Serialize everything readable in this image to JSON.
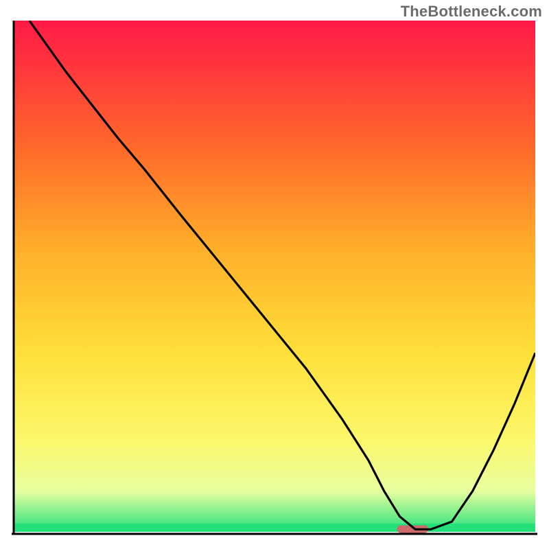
{
  "watermark": "TheBottleneck.com",
  "colors": {
    "gradient_top": "#ff1a47",
    "gradient_mid1": "#ff6a2a",
    "gradient_mid2": "#ffb02a",
    "gradient_mid3": "#ffe03a",
    "gradient_mid4": "#fcf86b",
    "gradient_low": "#e8ffa0",
    "gradient_green": "#23e07a",
    "curve": "#000000",
    "axis": "#000000",
    "marker": "#cf6a6a"
  },
  "chart_data": {
    "type": "line",
    "title": "",
    "xlabel": "",
    "ylabel": "",
    "xlim": [
      0,
      100
    ],
    "ylim": [
      0,
      100
    ],
    "x": [
      3,
      10,
      20,
      25,
      32,
      40,
      48,
      56,
      63,
      68,
      71,
      74,
      77,
      80,
      84,
      88,
      92,
      96,
      100
    ],
    "values": [
      100,
      90,
      77,
      71,
      62,
      52,
      42,
      32,
      22,
      14,
      8,
      3,
      0.5,
      0.5,
      2,
      8,
      16,
      25,
      35
    ],
    "marker": {
      "x_start": 73.5,
      "x_end": 79.5,
      "y": 0.6
    },
    "notes": "Curve depicts a bottleneck / mismatch metric that drops from ~100 at the left to ~0 near x≈76 (the optimum, highlighted by the pink marker on the green baseline) and rises again toward the right. Background is a vertical rainbow gradient (red → green) indicating goodness; axes are unlabeled."
  }
}
